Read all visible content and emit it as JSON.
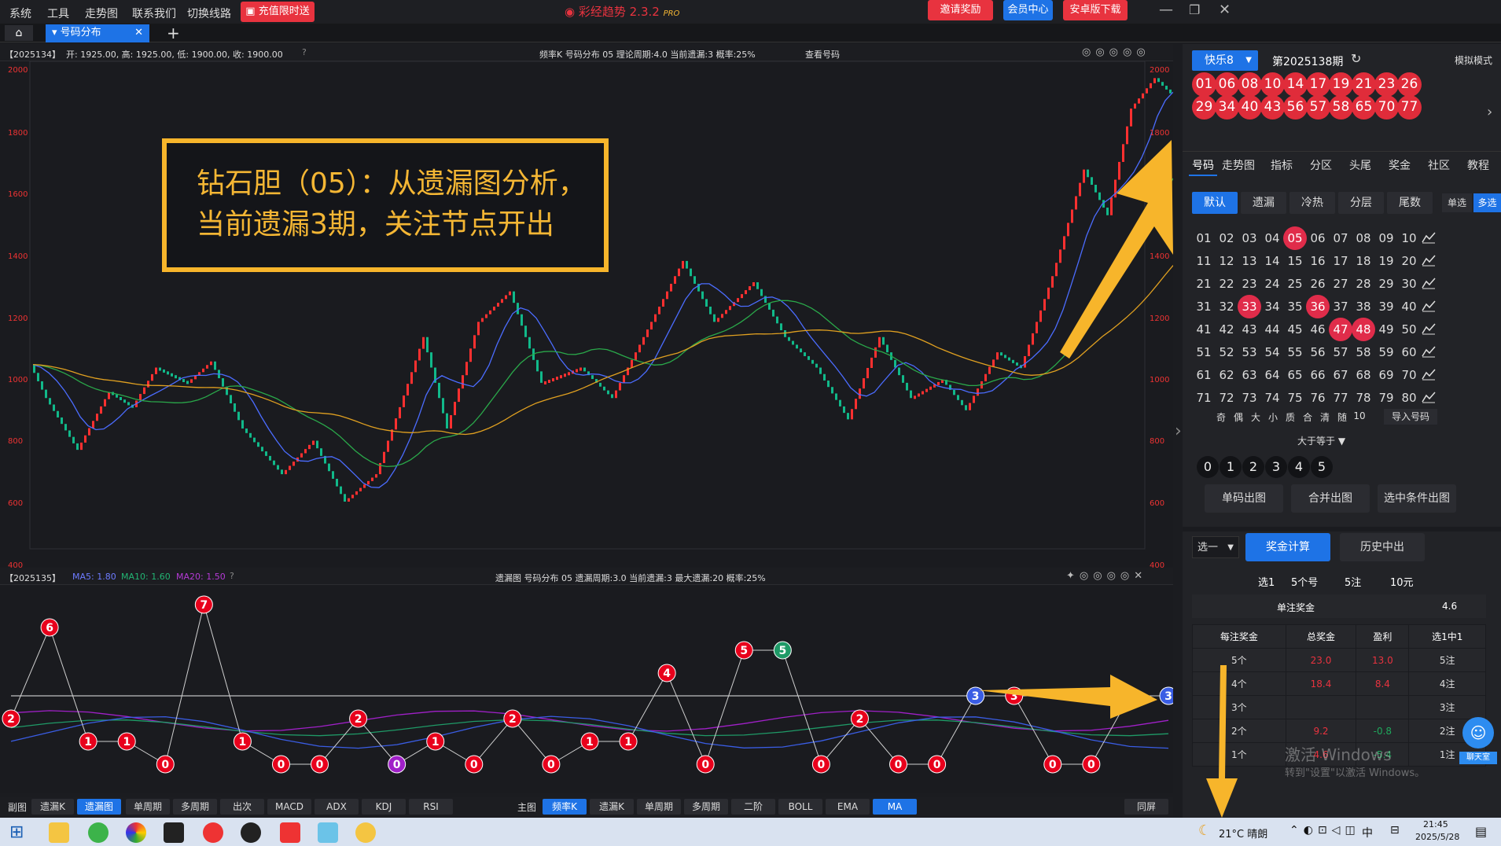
{
  "topbar": {
    "menu": [
      "系统",
      "工具",
      "走势图",
      "联系我们",
      "切换线路"
    ],
    "promo": "充值限时送",
    "app_title": "彩经趋势 2.3.2",
    "app_badge": "PRO",
    "invite": "邀请奖励",
    "member": "会员中心",
    "android": "安卓版下载"
  },
  "tabs": {
    "active": "号码分布"
  },
  "main_info": {
    "period": "【2025134】",
    "ohlc": "开: 1925.00, 高: 1925.00, 低: 1900.00, 收: 1900.00",
    "mid": "频率K  号码分布  05    理论周期:4.0  当前遗漏:3  概率:25%",
    "view": "查看号码",
    "yticks": [
      "2000",
      "1800",
      "1600",
      "1400",
      "1200",
      "1000",
      "800",
      "600",
      "400"
    ]
  },
  "annotation": {
    "line1": "钻石胆（05）：从遗漏图分析，",
    "line2": "当前遗漏3期，关注节点开出"
  },
  "sub_info": {
    "period": "【2025135】",
    "ma5": "MA5: 1.80",
    "ma10": "MA10: 1.60",
    "ma20": "MA20: 1.50",
    "mid": "遗漏图  号码分布  05    遗漏周期:3.0  当前遗漏:3  最大遗漏:20  概率:25%"
  },
  "sub_nodes": [
    2,
    6,
    1,
    1,
    0,
    7,
    1,
    0,
    0,
    2,
    0,
    1,
    0,
    2,
    0,
    1,
    1,
    4,
    0,
    5,
    5,
    0,
    2,
    0,
    0,
    3,
    3,
    0,
    0,
    3,
    3
  ],
  "sub_node_colors": {
    "red": "#e8001c",
    "blue": "#3a5de4",
    "green": "#1f9a67",
    "purple": "#a020c8"
  },
  "bottom_left": {
    "label": "副图",
    "buttons": [
      "遗漏K",
      "遗漏图",
      "单周期",
      "多周期",
      "出次",
      "MACD",
      "ADX",
      "KDJ",
      "RSI"
    ]
  },
  "bottom_right": {
    "label": "主图",
    "buttons": [
      "频率K",
      "遗漏K",
      "单周期",
      "多周期",
      "二阶",
      "BOLL",
      "EMA",
      "MA"
    ],
    "fullscreen": "同屏"
  },
  "right": {
    "lottery": "快乐8",
    "period": "第2025138期",
    "mode": "模拟模式",
    "balls": [
      "01",
      "06",
      "08",
      "10",
      "14",
      "17",
      "19",
      "21",
      "23",
      "26",
      "29",
      "34",
      "40",
      "43",
      "56",
      "57",
      "58",
      "65",
      "70",
      "77"
    ],
    "tabs": [
      "号码",
      "走势图",
      "指标",
      "分区",
      "头尾",
      "奖金",
      "社区",
      "教程"
    ],
    "modes": [
      "默认",
      "遗漏",
      "冷热",
      "分层",
      "尾数"
    ],
    "single": "单选",
    "multi": "多选",
    "numbers": [
      "01",
      "02",
      "03",
      "04",
      "05",
      "06",
      "07",
      "08",
      "09",
      "10",
      "11",
      "12",
      "13",
      "14",
      "15",
      "16",
      "17",
      "18",
      "19",
      "20",
      "21",
      "22",
      "23",
      "24",
      "25",
      "26",
      "27",
      "28",
      "29",
      "30",
      "31",
      "32",
      "33",
      "34",
      "35",
      "36",
      "37",
      "38",
      "39",
      "40",
      "41",
      "42",
      "43",
      "44",
      "45",
      "46",
      "47",
      "48",
      "49",
      "50",
      "51",
      "52",
      "53",
      "54",
      "55",
      "56",
      "57",
      "58",
      "59",
      "60",
      "61",
      "62",
      "63",
      "64",
      "65",
      "66",
      "67",
      "68",
      "69",
      "70",
      "71",
      "72",
      "73",
      "74",
      "75",
      "76",
      "77",
      "78",
      "79",
      "80"
    ],
    "selected": [
      "05",
      "33",
      "36",
      "47",
      "48"
    ],
    "filters": [
      "奇",
      "偶",
      "大",
      "小",
      "质",
      "合",
      "清",
      "随",
      "10"
    ],
    "import": "导入号码",
    "gte": "大于等于",
    "counts": [
      "0",
      "1",
      "2",
      "3",
      "4",
      "5"
    ],
    "out_buttons": [
      "单码出图",
      "合并出图",
      "选中条件出图"
    ],
    "pick": "选一",
    "calc": "奖金计算",
    "history": "历史中出",
    "summary": [
      "选1",
      "5个号",
      "5注",
      "10元"
    ],
    "single_prize_label": "单注奖金",
    "single_prize": "4.6",
    "table_head": [
      "每注奖金",
      "总奖金",
      "盈利",
      "选1中1"
    ],
    "rows": [
      [
        "5个",
        "23.0",
        "13.0",
        "5注"
      ],
      [
        "4个",
        "18.4",
        "8.4",
        "4注"
      ],
      [
        "3个",
        "",
        "",
        "3注"
      ],
      [
        "2个",
        "9.2",
        "-0.8",
        "2注"
      ],
      [
        "1个",
        "4.6",
        "-5.4",
        "1注"
      ]
    ]
  },
  "watermark": {
    "line1": "激活 Windows",
    "line2": "转到\"设置\"以激活 Windows。"
  },
  "help": "聊天室",
  "taskbar": {
    "weather": "21°C  晴朗",
    "ime": "中",
    "time": "21:45",
    "date": "2025/5/28"
  }
}
